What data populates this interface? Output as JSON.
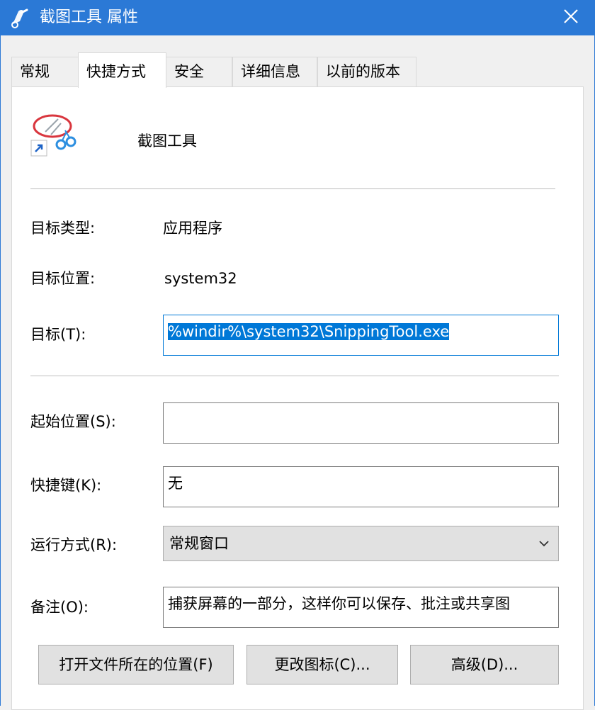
{
  "window": {
    "title": "截图工具 属性"
  },
  "tabs": [
    {
      "label": "常规"
    },
    {
      "label": "快捷方式"
    },
    {
      "label": "安全"
    },
    {
      "label": "详细信息"
    },
    {
      "label": "以前的版本"
    }
  ],
  "app": {
    "name": "截图工具"
  },
  "fields": {
    "target_type": {
      "label": "目标类型:",
      "value": "应用程序"
    },
    "target_location": {
      "label": "目标位置:",
      "value": "system32"
    },
    "target": {
      "label": "目标(T):",
      "value": "%windir%\\system32\\SnippingTool.exe"
    },
    "start_in": {
      "label": "起始位置(S):",
      "value": ""
    },
    "shortcut_key": {
      "label": "快捷键(K):",
      "value": "无"
    },
    "run": {
      "label": "运行方式(R):",
      "value": "常规窗口"
    },
    "comment": {
      "label": "备注(O):",
      "value": "捕获屏幕的一部分，这样你可以保存、批注或共享图"
    }
  },
  "buttons": {
    "open_location": "打开文件所在的位置(F)",
    "change_icon": "更改图标(C)...",
    "advanced": "高级(D)..."
  },
  "colors": {
    "titlebar": "#2b79d6",
    "selection": "#0078d7"
  }
}
